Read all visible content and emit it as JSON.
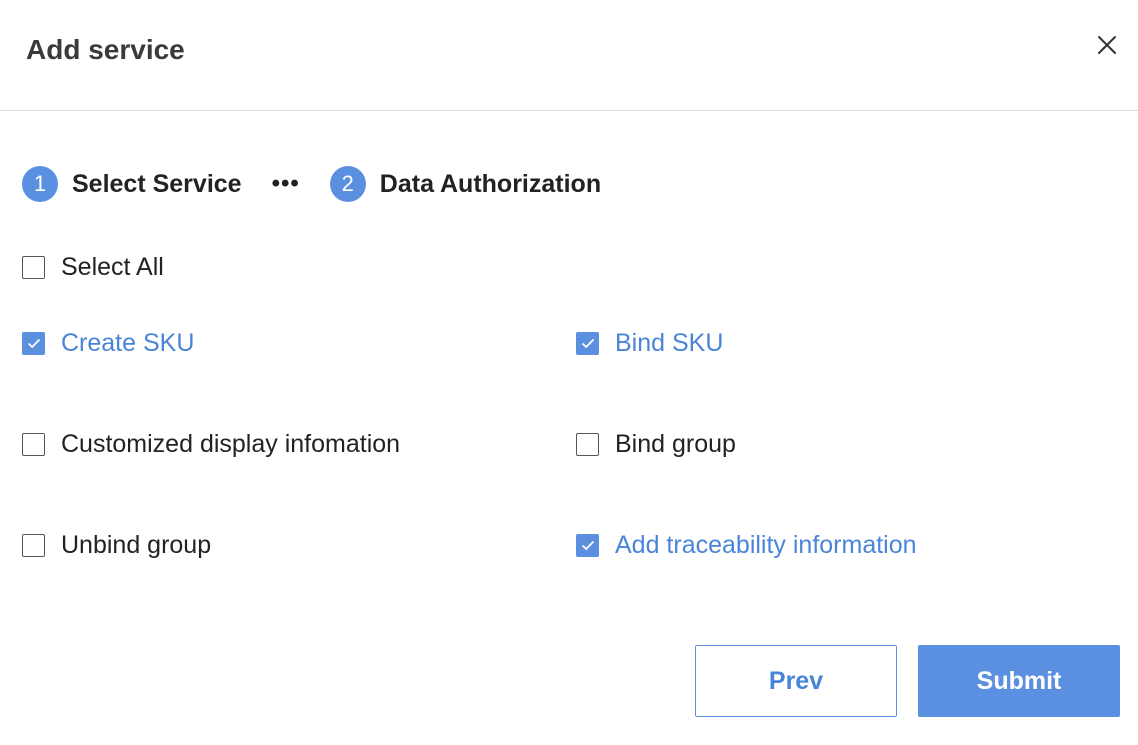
{
  "dialog": {
    "title": "Add service",
    "close_icon": "close-icon"
  },
  "steps": [
    {
      "number": "1",
      "label": "Select Service",
      "active": true
    },
    {
      "number": "2",
      "label": "Data Authorization",
      "active": true
    }
  ],
  "step_separator": "•••",
  "select_all": {
    "label": "Select All",
    "checked": false
  },
  "services": [
    {
      "label": "Create SKU",
      "checked": true
    },
    {
      "label": "Bind SKU",
      "checked": true
    },
    {
      "label": "Customized display infomation",
      "checked": false
    },
    {
      "label": "Bind group",
      "checked": false
    },
    {
      "label": "Unbind group",
      "checked": false
    },
    {
      "label": "Add traceability information",
      "checked": true
    }
  ],
  "footer": {
    "prev_label": "Prev",
    "submit_label": "Submit"
  },
  "colors": {
    "accent": "#5b8fe0",
    "accent_text": "#4a84d8",
    "text": "#222222",
    "divider": "#d9d9d9"
  }
}
